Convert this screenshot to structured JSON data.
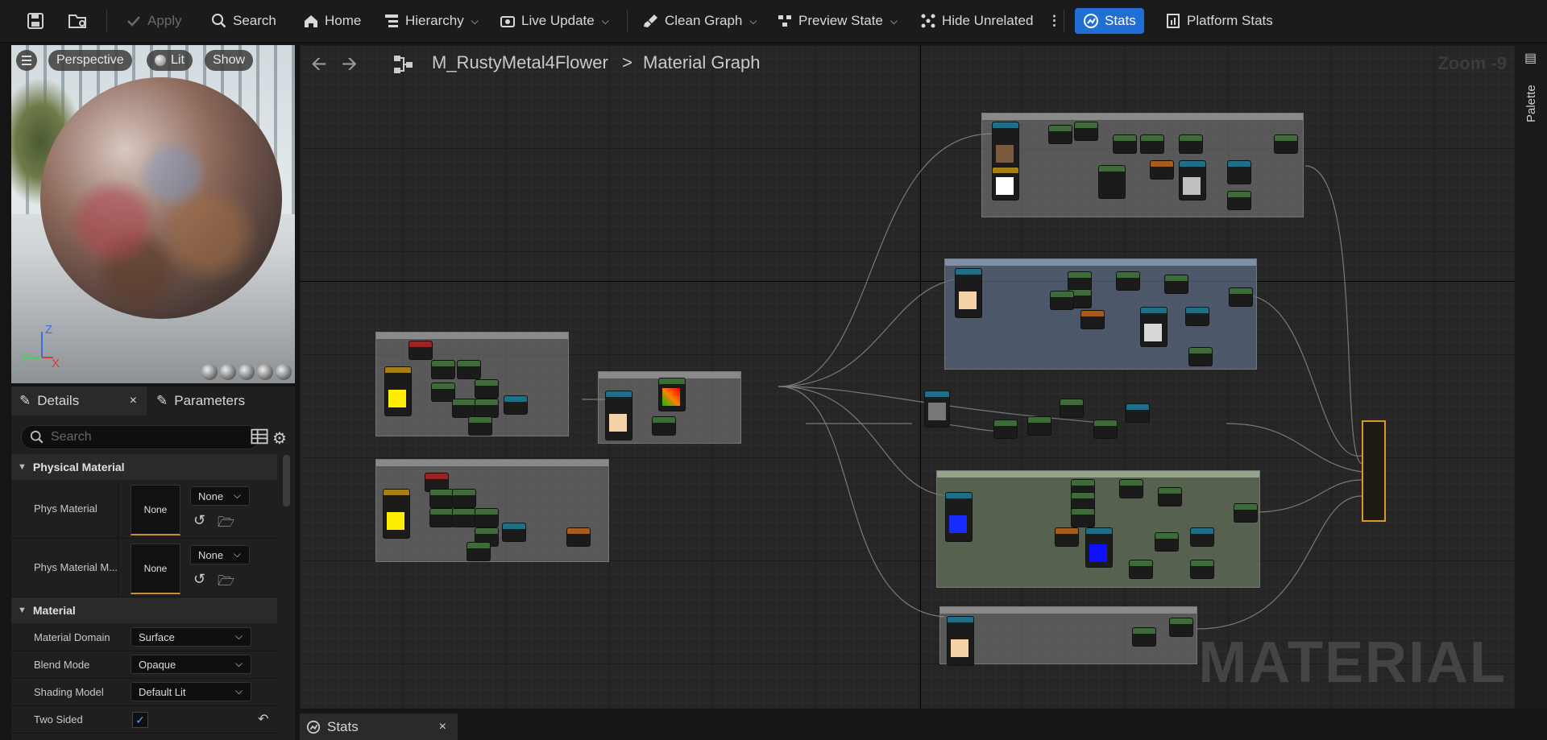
{
  "toolbar": {
    "apply": "Apply",
    "search": "Search",
    "home": "Home",
    "hierarchy": "Hierarchy",
    "live_update": "Live Update",
    "clean_graph": "Clean Graph",
    "preview_state": "Preview State",
    "hide_unrelated": "Hide Unrelated",
    "stats": "Stats",
    "platform_stats": "Platform Stats"
  },
  "viewport": {
    "perspective": "Perspective",
    "lit": "Lit",
    "show": "Show",
    "axis_z": "Z",
    "axis_x": "X",
    "axis_y": "Y"
  },
  "details": {
    "tab_details": "Details",
    "tab_parameters": "Parameters",
    "search_placeholder": "Search",
    "physical_material_section": "Physical Material",
    "phys_material_label": "Phys Material",
    "phys_material_thumb": "None",
    "phys_material_value": "None",
    "phys_material_mask_label": "Phys Material M...",
    "phys_material_mask_thumb": "None",
    "phys_material_mask_value": "None",
    "material_section": "Material",
    "material_domain_label": "Material Domain",
    "material_domain_value": "Surface",
    "blend_mode_label": "Blend Mode",
    "blend_mode_value": "Opaque",
    "shading_model_label": "Shading Model",
    "shading_model_value": "Default Lit",
    "two_sided_label": "Two Sided",
    "two_sided_checked": true
  },
  "graph": {
    "breadcrumb_asset": "M_RustyMetal4Flower",
    "breadcrumb_sep": ">",
    "breadcrumb_graph": "Material Graph",
    "zoom": "Zoom -9",
    "watermark": "MATERIAL"
  },
  "right_panel": {
    "palette": "Palette"
  },
  "bottom": {
    "stats_tab": "Stats"
  },
  "colors": {
    "accent": "#1f6fd6",
    "result_node": "#d89a22",
    "comment_blue": "#5c6d86",
    "comment_green": "#6c7a62"
  }
}
